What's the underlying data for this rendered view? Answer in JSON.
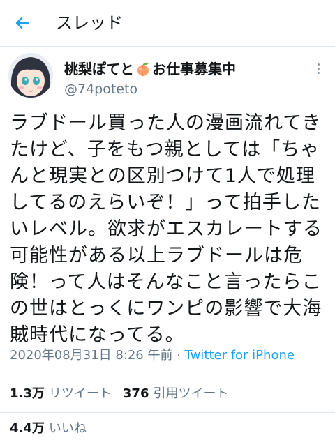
{
  "header": {
    "title": "スレッド",
    "back_icon": "arrow-left-icon",
    "accent_color": "#1da1f2"
  },
  "tweet": {
    "display_name_before": "桃梨ぽてと",
    "display_name_emoji": "peach-icon",
    "display_name_after": "お仕事募集中",
    "handle": "@74poteto",
    "more_icon": "more-vertical-icon",
    "text_lines": [
      "ラブドール買った人の漫画流れてき",
      "たけど、子をもつ親としては「ちゃ",
      "んと現実との区別つけて1人で処理",
      "してるのえらいぞ！」って拍手した",
      "いレベル。欲求がエスカレートする",
      "可能性がある以上ラブドールは危",
      "険！って人はそんなこと言ったらこ",
      "の世はとっくにワンピの影響で大海",
      "賊時代になってる。"
    ],
    "timestamp": "2020年08月31日 8:26 午前",
    "separator": " · ",
    "source": "Twitter for iPhone"
  },
  "stats": {
    "retweets_count": "1.3万",
    "retweets_label": "リツイート",
    "quotes_count": "376",
    "quotes_label": "引用ツイート",
    "likes_count": "4.4万",
    "likes_label": "いいね"
  }
}
